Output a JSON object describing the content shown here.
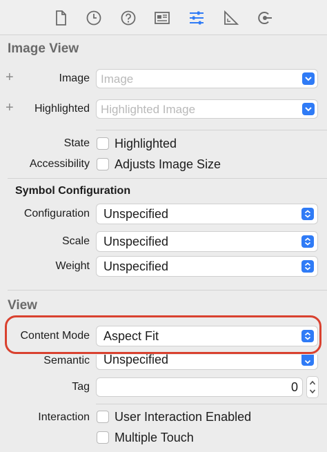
{
  "colors": {
    "accent": "#2f7bf6",
    "highlight_outline": "#d9412f"
  },
  "toolbar": {
    "icons": [
      "file-icon",
      "history-icon",
      "help-icon",
      "identity-icon",
      "attributes-icon",
      "size-icon",
      "connections-icon"
    ]
  },
  "image_view": {
    "title": "Image View",
    "image_label": "Image",
    "image_placeholder": "Image",
    "highlighted_label": "Highlighted",
    "highlighted_placeholder": "Highlighted Image",
    "state_label": "State",
    "state_checkbox": "Highlighted",
    "accessibility_label": "Accessibility",
    "accessibility_checkbox": "Adjusts Image Size"
  },
  "symbol_configuration": {
    "title": "Symbol Configuration",
    "configuration_label": "Configuration",
    "configuration_value": "Unspecified",
    "scale_label": "Scale",
    "scale_value": "Unspecified",
    "weight_label": "Weight",
    "weight_value": "Unspecified"
  },
  "view": {
    "title": "View",
    "content_mode_label": "Content Mode",
    "content_mode_value": "Aspect Fit",
    "semantic_label": "Semantic",
    "semantic_value": "Unspecified",
    "tag_label": "Tag",
    "tag_value": "0",
    "interaction_label": "Interaction",
    "interaction_checkbox_1": "User Interaction Enabled",
    "interaction_checkbox_2": "Multiple Touch"
  }
}
